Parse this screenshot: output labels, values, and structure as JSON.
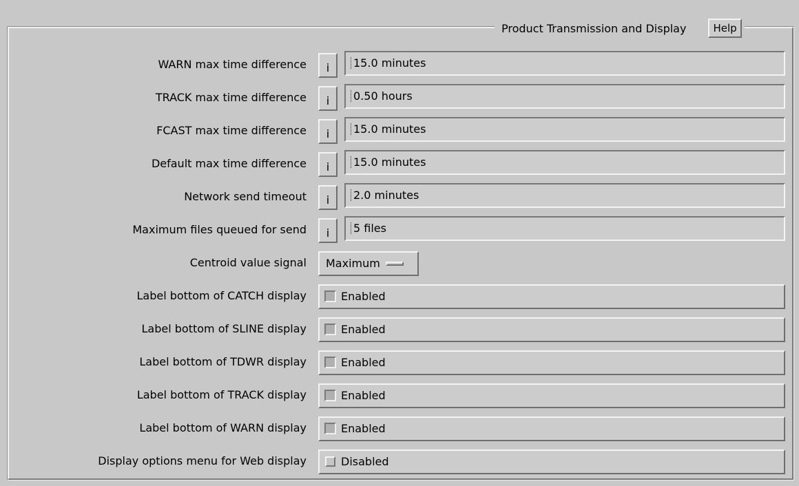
{
  "panel": {
    "title": "Product Transmission and Display",
    "help_label": "Help"
  },
  "info_label": "i",
  "fields": [
    {
      "label": "WARN max time difference",
      "value": "15.0 minutes"
    },
    {
      "label": "TRACK max time difference",
      "value": "0.50 hours"
    },
    {
      "label": "FCAST max time difference",
      "value": "15.0 minutes"
    },
    {
      "label": "Default max time difference",
      "value": "15.0 minutes"
    },
    {
      "label": "Network send timeout",
      "value": "2.0 minutes"
    },
    {
      "label": "Maximum files queued for send",
      "value": "5 files"
    }
  ],
  "centroid": {
    "label": "Centroid value signal",
    "selected": "Maximum"
  },
  "toggles": [
    {
      "label": "Label bottom of CATCH display",
      "state": "Enabled",
      "checked": true
    },
    {
      "label": "Label bottom of SLINE display",
      "state": "Enabled",
      "checked": true
    },
    {
      "label": "Label bottom of TDWR display",
      "state": "Enabled",
      "checked": true
    },
    {
      "label": "Label bottom of TRACK display",
      "state": "Enabled",
      "checked": true
    },
    {
      "label": "Label bottom of WARN display",
      "state": "Enabled",
      "checked": true
    },
    {
      "label": "Display options menu for Web display",
      "state": "Disabled",
      "checked": false
    }
  ]
}
